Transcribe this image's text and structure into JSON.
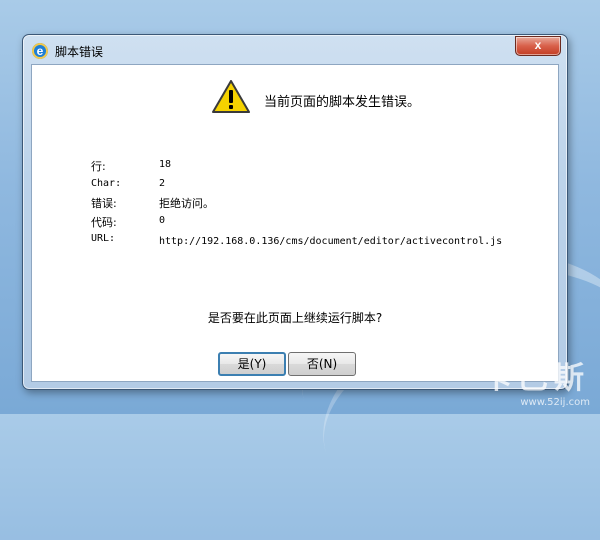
{
  "window": {
    "title": "脚本错误",
    "close_label": "x"
  },
  "dialog": {
    "headline": "当前页面的脚本发生错误。",
    "details": [
      {
        "label": "行:",
        "value": "18"
      },
      {
        "label": "Char:",
        "value": "2"
      },
      {
        "label": "错误:",
        "value": "拒绝访问。"
      },
      {
        "label": "代码:",
        "value": "0"
      },
      {
        "label": "URL:",
        "value": "http://192.168.0.136/cms/document/editor/activecontrol.js"
      }
    ],
    "question": "是否要在此页面上继续运行脚本?",
    "buttons": {
      "yes": "是(Y)",
      "no": "否(N)"
    }
  },
  "watermark": {
    "large": "卡巴斯",
    "small": "www.52ij.com"
  },
  "icons": {
    "app": "ie-icon",
    "warning": "warning-triangle-icon"
  },
  "colors": {
    "warning_fill": "#f5d200",
    "close_button": "#c9452b",
    "default_button_border": "#3c7fb1"
  }
}
